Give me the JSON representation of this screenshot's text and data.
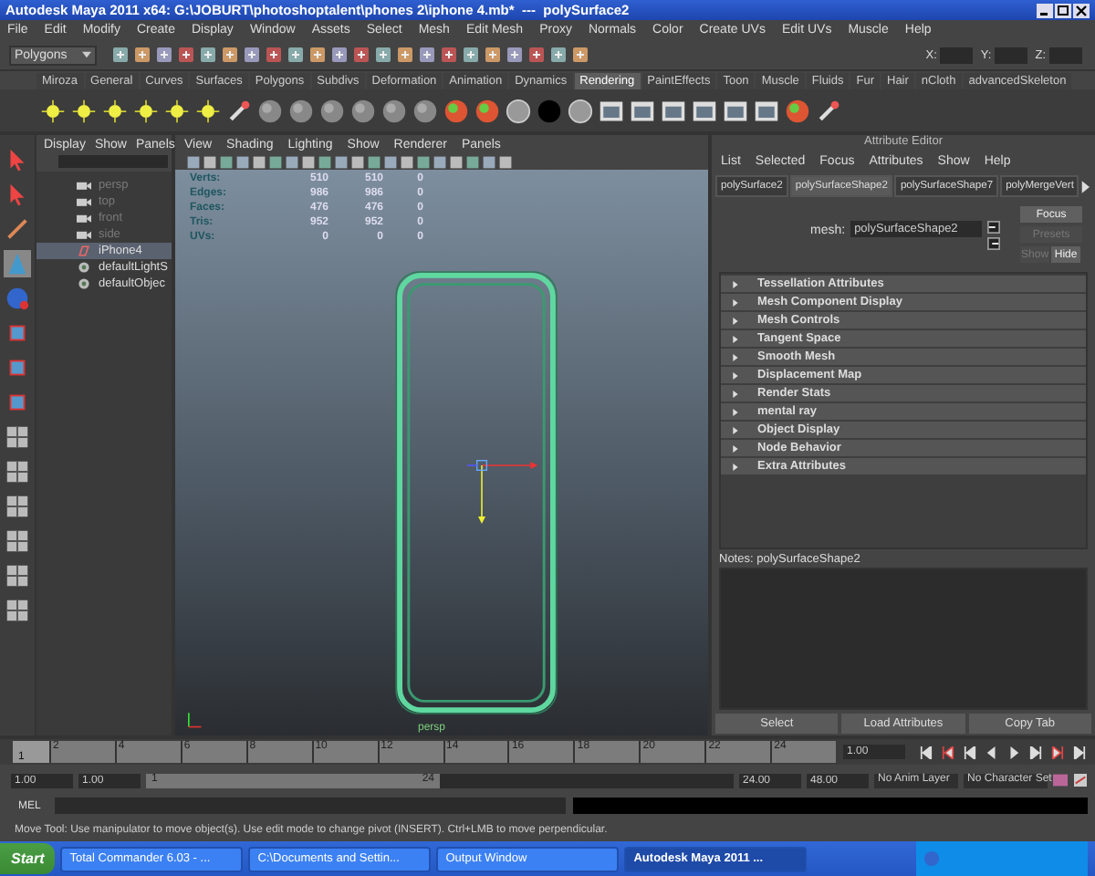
{
  "window": {
    "title": "Autodesk Maya 2011 x64: G:\\JOBURT\\photoshoptalent\\phones 2\\iphone 4.mb*  ---  polySurface2"
  },
  "menu_bar": [
    "File",
    "Edit",
    "Modify",
    "Create",
    "Display",
    "Window",
    "Assets",
    "Select",
    "Mesh",
    "Edit Mesh",
    "Proxy",
    "Normals",
    "Color",
    "Create UVs",
    "Edit UVs",
    "Muscle",
    "Help"
  ],
  "status_line": {
    "menu_set": "Polygons",
    "coord_labels": [
      "X:",
      "Y:",
      "Z:"
    ]
  },
  "shelf_tabs": [
    {
      "label": "Miroza",
      "selected": false
    },
    {
      "label": "General",
      "selected": false
    },
    {
      "label": "Curves",
      "selected": false
    },
    {
      "label": "Surfaces",
      "selected": false
    },
    {
      "label": "Polygons",
      "selected": false
    },
    {
      "label": "Subdivs",
      "selected": false
    },
    {
      "label": "Deformation",
      "selected": false
    },
    {
      "label": "Animation",
      "selected": false
    },
    {
      "label": "Dynamics",
      "selected": false
    },
    {
      "label": "Rendering",
      "selected": true
    },
    {
      "label": "PaintEffects",
      "selected": false
    },
    {
      "label": "Toon",
      "selected": false
    },
    {
      "label": "Muscle",
      "selected": false
    },
    {
      "label": "Fluids",
      "selected": false
    },
    {
      "label": "Fur",
      "selected": false
    },
    {
      "label": "Hair",
      "selected": false
    },
    {
      "label": "nCloth",
      "selected": false
    },
    {
      "label": "advancedSkeleton",
      "selected": false
    }
  ],
  "outliner": {
    "menus": [
      "Display",
      "Show",
      "Panels"
    ],
    "items": [
      {
        "label": "persp",
        "hidden": true,
        "selected": false,
        "kind": "camera"
      },
      {
        "label": "top",
        "hidden": true,
        "selected": false,
        "kind": "camera"
      },
      {
        "label": "front",
        "hidden": true,
        "selected": false,
        "kind": "camera"
      },
      {
        "label": "side",
        "hidden": true,
        "selected": false,
        "kind": "camera"
      },
      {
        "label": "iPhone4",
        "hidden": false,
        "selected": true,
        "kind": "mesh"
      },
      {
        "label": "defaultLightS",
        "hidden": false,
        "selected": false,
        "kind": "set"
      },
      {
        "label": "defaultObjec",
        "hidden": false,
        "selected": false,
        "kind": "set"
      }
    ]
  },
  "viewport": {
    "menus": [
      "View",
      "Shading",
      "Lighting",
      "Show",
      "Renderer",
      "Panels"
    ],
    "hud": [
      [
        "Verts:",
        "510",
        "510",
        "0"
      ],
      [
        "Edges:",
        "986",
        "986",
        "0"
      ],
      [
        "Faces:",
        "476",
        "476",
        "0"
      ],
      [
        "Tris:",
        "952",
        "952",
        "0"
      ],
      [
        "UVs:",
        "0",
        "0",
        "0"
      ]
    ],
    "camera_label": "persp"
  },
  "attribute_editor": {
    "title": "Attribute Editor",
    "menus": [
      "List",
      "Selected",
      "Focus",
      "Attributes",
      "Show",
      "Help"
    ],
    "tabs": [
      {
        "label": "polySurface2",
        "selected": false
      },
      {
        "label": "polySurfaceShape2",
        "selected": true
      },
      {
        "label": "polySurfaceShape7",
        "selected": false
      },
      {
        "label": "polyMergeVert",
        "selected": false
      }
    ],
    "node_label": "mesh:",
    "node_value": "polySurfaceShape2",
    "side_buttons": [
      {
        "label": "Focus",
        "disabled": false
      },
      {
        "label": "Presets",
        "disabled": true
      }
    ],
    "show_hide": [
      {
        "label": "Show",
        "disabled": true
      },
      {
        "label": "Hide",
        "disabled": false
      }
    ],
    "sections": [
      {
        "label": "Tessellation Attributes",
        "expanded": false
      },
      {
        "label": "Mesh Component Display",
        "expanded": false
      },
      {
        "label": "Mesh Controls",
        "expanded": false
      },
      {
        "label": "Tangent Space",
        "expanded": false
      },
      {
        "label": "Smooth Mesh",
        "expanded": false
      },
      {
        "label": "Displacement Map",
        "expanded": false
      },
      {
        "label": "Render Stats",
        "expanded": false
      },
      {
        "label": "mental ray",
        "expanded": false
      },
      {
        "label": "Object Display",
        "expanded": false
      },
      {
        "label": "Node Behavior",
        "expanded": false
      },
      {
        "label": "Extra Attributes",
        "expanded": false
      }
    ],
    "notes_label": "Notes:  polySurfaceShape2",
    "buttons": [
      "Select",
      "Load Attributes",
      "Copy Tab"
    ]
  },
  "time_slider": {
    "ticks": [
      "2",
      "4",
      "6",
      "8",
      "10",
      "12",
      "14",
      "16",
      "18",
      "20",
      "22",
      "24"
    ],
    "current": "1",
    "level": 0,
    "current_field": "1.00"
  },
  "range_slider": {
    "start": "1.00",
    "range_start": "1.00",
    "handle_start": "1",
    "handle_end": "24",
    "level": 0.5,
    "range_end": "24.00",
    "end": "48.00",
    "anim_layer": "No Anim Layer",
    "character_set": "No Character Set"
  },
  "command_line": {
    "label": "MEL"
  },
  "help_line": "Move Tool: Use manipulator to move object(s). Use edit mode to change pivot (INSERT). Ctrl+LMB to move perpendicular.",
  "taskbar": {
    "start": "Start",
    "items": [
      {
        "label": "Total Commander 6.03 - ...",
        "selected": false
      },
      {
        "label": "C:\\Documents and Settin...",
        "selected": false
      },
      {
        "label": "Output Window",
        "selected": false
      },
      {
        "label": "Autodesk Maya 2011 ...",
        "selected": true
      }
    ]
  }
}
